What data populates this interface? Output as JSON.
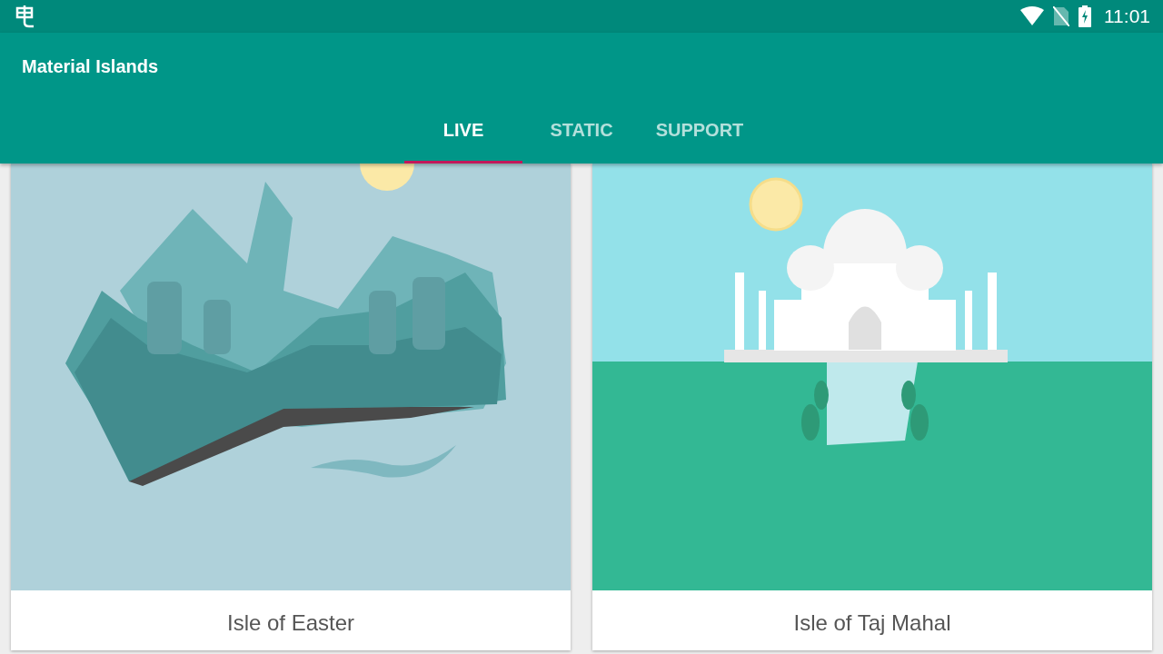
{
  "status_bar": {
    "time": "11:01"
  },
  "app_bar": {
    "title": "Material Islands"
  },
  "tabs": [
    {
      "label": "LIVE",
      "selected": true
    },
    {
      "label": "STATIC",
      "selected": false
    },
    {
      "label": "SUPPORT",
      "selected": false
    }
  ],
  "cards": [
    {
      "kind": "easter",
      "title": "Isle of Easter"
    },
    {
      "kind": "taj",
      "title": "Isle of Taj Mahal"
    }
  ]
}
